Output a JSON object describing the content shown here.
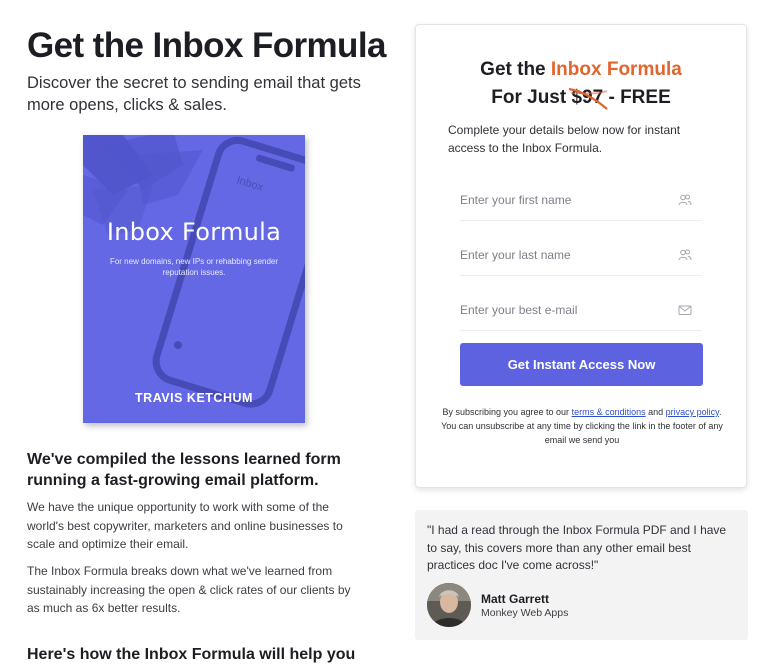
{
  "left": {
    "headline": "Get the Inbox Formula",
    "subhead": "Discover the secret to sending email that gets more opens, clicks & sales.",
    "book": {
      "title": "Inbox Formula",
      "subtitle": "For new domains, new IPs or rehabbing sender reputation issues.",
      "author": "TRAVIS KETCHUM",
      "phone_text": "Inbox"
    },
    "section_title": "We've compiled the lessons learned form running a fast-growing email platform.",
    "paragraph_1": "We have the unique opportunity to work with some of the world's best copywriter, marketers and online businesses to scale and optimize their email.",
    "paragraph_2": "The Inbox Formula breaks down what we've learned from sustainably increasing the open & click rates of our clients by as much as 6x better results.",
    "next_title": "Here's how the Inbox Formula will help you"
  },
  "form": {
    "heading_prefix": "Get the ",
    "heading_accent": "Inbox Formula",
    "price_prefix": "For Just ",
    "old_price": "$97",
    "price_suffix": " - FREE",
    "description": "Complete your details below now for instant access to the Inbox Formula.",
    "first_name_placeholder": "Enter your first name",
    "last_name_placeholder": "Enter your last name",
    "email_placeholder": "Enter your best e-mail",
    "submit_label": "Get Instant Access Now",
    "legal_1": "By subscribing you agree to our ",
    "terms_link": "terms & conditions",
    "legal_2": " and ",
    "privacy_link": "privacy policy",
    "legal_3": ".  You can unsubscribe at any time by clicking the link in the footer of any email we send you",
    "icons": [
      "users-icon",
      "users-icon",
      "envelope-icon"
    ]
  },
  "testimonial": {
    "quote": "\"I had a read through the Inbox Formula PDF and I have to say, this covers more than any other email best practices doc I've come across!\"",
    "name": "Matt Garrett",
    "company": "Monkey Web Apps"
  },
  "colors": {
    "accent": "#e2652e",
    "button": "#5d63e0",
    "book": "#6468e4",
    "link": "#2d4fcf"
  }
}
